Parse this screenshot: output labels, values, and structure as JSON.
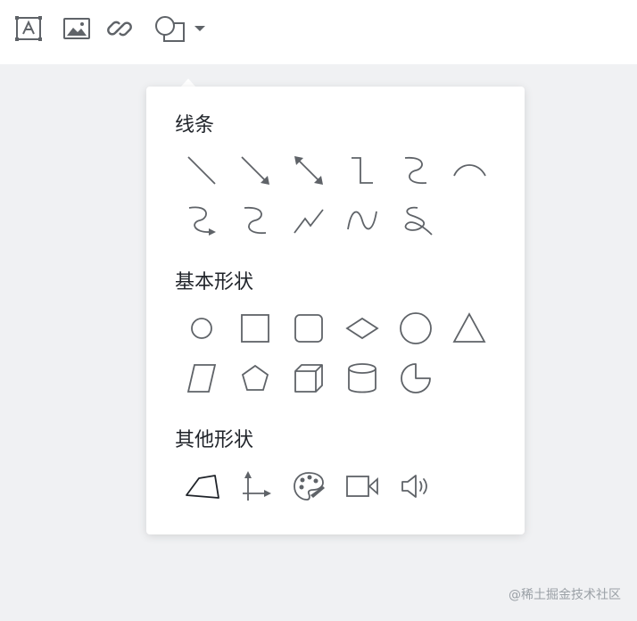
{
  "toolbar": {
    "icons": [
      "text-box-icon",
      "image-icon",
      "link-icon",
      "shape-icon",
      "caret-down-icon"
    ]
  },
  "popover": {
    "sections": [
      {
        "title": "线条",
        "icons": [
          "line-icon",
          "arrow-icon",
          "double-arrow-icon",
          "elbow-connector-icon",
          "curved-connector-icon",
          "arc-icon",
          "curved-arrow-icon",
          "s-curve-icon",
          "zigzag-line-icon",
          "wave-line-icon",
          "freehand-scribble-icon"
        ]
      },
      {
        "title": "基本形状",
        "icons": [
          "small-circle-icon",
          "square-icon",
          "rounded-square-icon",
          "diamond-icon",
          "circle-icon",
          "triangle-icon",
          "parallelogram-icon",
          "pentagon-icon",
          "cube-icon",
          "cylinder-icon",
          "pie-icon"
        ]
      },
      {
        "title": "其他形状",
        "icons": [
          "quadrilateral-icon",
          "axes-icon",
          "palette-icon",
          "video-icon",
          "speaker-icon"
        ]
      }
    ]
  },
  "watermark": "@稀土掘金技术社区",
  "colors": {
    "icon": "#5f6368",
    "title": "#1f2329",
    "panel": "#ffffff",
    "page": "#f0f1f3"
  }
}
